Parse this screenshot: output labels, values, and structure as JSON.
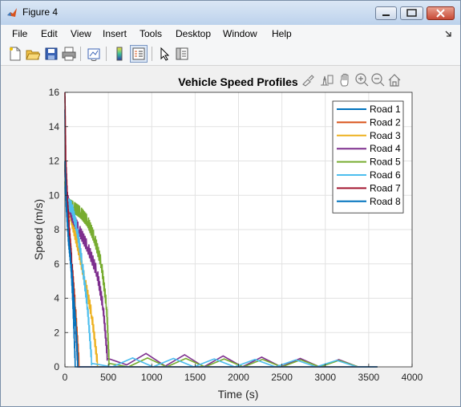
{
  "window": {
    "title": "Figure 4"
  },
  "menu": [
    "File",
    "Edit",
    "View",
    "Insert",
    "Tools",
    "Desktop",
    "Window",
    "Help"
  ],
  "toolbar_icons": [
    "new-figure-icon",
    "open-file-icon",
    "save-icon",
    "print-icon",
    "link-plot-icon",
    "colorbar-icon",
    "legend-icon",
    "pointer-icon",
    "property-inspector-icon"
  ],
  "axes_toolbar_icons": [
    "brush-icon",
    "data-cursor-icon",
    "pan-icon",
    "zoom-in-icon",
    "zoom-out-icon",
    "home-icon"
  ],
  "colors": {
    "figure_bg": "#f0f0f0",
    "axes_bg": "#ffffff",
    "grid": "#e2e2e2"
  },
  "chart_data": {
    "type": "line",
    "title": "Vehicle Speed Profiles",
    "xlabel": "Time (s)",
    "ylabel": "Speed (m/s)",
    "xlim": [
      0,
      4000
    ],
    "ylim": [
      0,
      16
    ],
    "xticks": [
      "0",
      "500",
      "1000",
      "1500",
      "2000",
      "2500",
      "3000",
      "3500",
      "4000"
    ],
    "yticks": [
      "0",
      "2",
      "4",
      "6",
      "8",
      "10",
      "12",
      "14",
      "16"
    ],
    "grid": true,
    "legend_position": "top-right",
    "series": [
      {
        "name": "Road 1",
        "color": "#0072bd",
        "x": [
          0,
          5,
          30,
          60,
          90,
          120,
          3600
        ],
        "y": [
          15,
          12,
          9.5,
          7,
          4,
          0,
          0
        ]
      },
      {
        "name": "Road 2",
        "color": "#d95319",
        "x": [
          0,
          10,
          40,
          80,
          120,
          165,
          3600
        ],
        "y": [
          11.8,
          10.5,
          8.5,
          6,
          3.5,
          0,
          0
        ]
      },
      {
        "name": "Road 3",
        "color": "#edb120",
        "x": [
          0,
          20,
          80,
          150,
          230,
          310,
          380,
          3600
        ],
        "y": [
          11.8,
          10,
          8.5,
          7,
          5,
          3,
          0,
          0
        ]
      },
      {
        "name": "Road 4",
        "color": "#7e2f8e",
        "x": [
          0,
          20,
          80,
          160,
          260,
          370,
          440,
          490,
          3600
        ],
        "y": [
          11.5,
          10,
          8.8,
          8,
          7,
          5.5,
          3.5,
          0.5,
          0
        ]
      },
      {
        "name": "Road 5",
        "color": "#77ac30",
        "x": [
          0,
          30,
          100,
          180,
          260,
          340,
          420,
          480,
          510,
          3600
        ],
        "y": [
          10.8,
          9.5,
          9.3,
          9,
          8.5,
          7.5,
          6,
          3.5,
          0.2,
          0
        ]
      },
      {
        "name": "Road 6",
        "color": "#4dbeee",
        "x": [
          0,
          30,
          80,
          140,
          200,
          260,
          310,
          3600
        ],
        "y": [
          10.5,
          9.5,
          9.3,
          8,
          6,
          3.5,
          0.2,
          0
        ]
      },
      {
        "name": "Road 7",
        "color": "#a2142f",
        "x": [
          0,
          10,
          30,
          50,
          80,
          110,
          150,
          3600
        ],
        "y": [
          16,
          12,
          9.5,
          8,
          6,
          3.5,
          0,
          0
        ]
      },
      {
        "name": "Road 8",
        "color": "#0072bd",
        "x": [
          0,
          15,
          40,
          70,
          100,
          130,
          150,
          3600
        ],
        "y": [
          12,
          9.5,
          7.5,
          6,
          4,
          2,
          0,
          0
        ]
      }
    ]
  }
}
